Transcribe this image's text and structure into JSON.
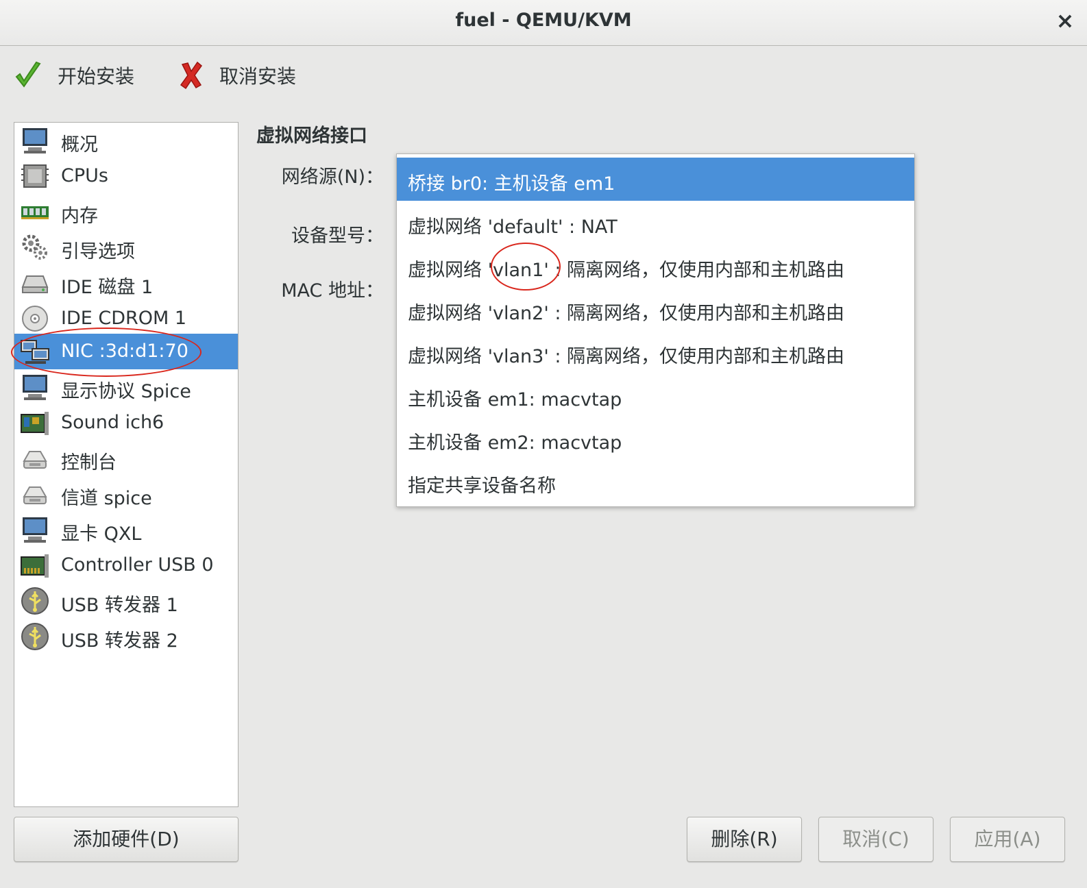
{
  "window": {
    "title": "fuel - QEMU/KVM",
    "close_glyph": "×"
  },
  "toolbar": {
    "begin_install": {
      "label": "开始安装",
      "icon": "checkmark-icon",
      "color": "#5ab532"
    },
    "cancel_install": {
      "label": "取消安装",
      "icon": "red-x-icon",
      "color": "#d42a24"
    }
  },
  "sidebar": {
    "items": [
      {
        "label": "概况",
        "icon": "monitor-icon"
      },
      {
        "label": "CPUs",
        "icon": "cpu-chip-icon"
      },
      {
        "label": "内存",
        "icon": "memory-module-icon"
      },
      {
        "label": "引导选项",
        "icon": "gears-icon"
      },
      {
        "label": "IDE 磁盘 1",
        "icon": "hard-disk-icon"
      },
      {
        "label": "IDE CDROM 1",
        "icon": "cdrom-icon"
      },
      {
        "label": "NIC :3d:d1:70",
        "icon": "network-card-icon",
        "selected": true
      },
      {
        "label": "显示协议 Spice",
        "icon": "display-icon"
      },
      {
        "label": "Sound ich6",
        "icon": "sound-card-icon"
      },
      {
        "label": "控制台",
        "icon": "serial-device-icon"
      },
      {
        "label": "信道 spice",
        "icon": "channel-device-icon"
      },
      {
        "label": "显卡 QXL",
        "icon": "video-card-icon"
      },
      {
        "label": "Controller USB 0",
        "icon": "controller-card-icon"
      },
      {
        "label": "USB 转发器 1",
        "icon": "usb-icon"
      },
      {
        "label": "USB 转发器 2",
        "icon": "usb-icon"
      }
    ],
    "selection_color": "#4a90d9"
  },
  "detail": {
    "section_title": "虚拟网络接口",
    "network_source_label": "网络源(N)：",
    "device_model_label": "设备型号：",
    "mac_label": "MAC 地址："
  },
  "network_source_options": [
    {
      "label": "桥接 br0: 主机设备 em1",
      "selected": true
    },
    {
      "label": "虚拟网络 'default' : NAT"
    },
    {
      "label": "虚拟网络 'vlan1' : 隔离网络，仅使用内部和主机路由"
    },
    {
      "label": "虚拟网络 'vlan2' : 隔离网络，仅使用内部和主机路由"
    },
    {
      "label": "虚拟网络 'vlan3' : 隔离网络，仅使用内部和主机路由"
    },
    {
      "label": "主机设备 em1: macvtap"
    },
    {
      "label": "主机设备 em2: macvtap"
    },
    {
      "label": "指定共享设备名称"
    }
  ],
  "annotation_color": "#d9261c",
  "buttons": {
    "add_hardware": "添加硬件(D)",
    "remove": "删除(R)",
    "cancel": "取消(C)",
    "apply": "应用(A)"
  }
}
